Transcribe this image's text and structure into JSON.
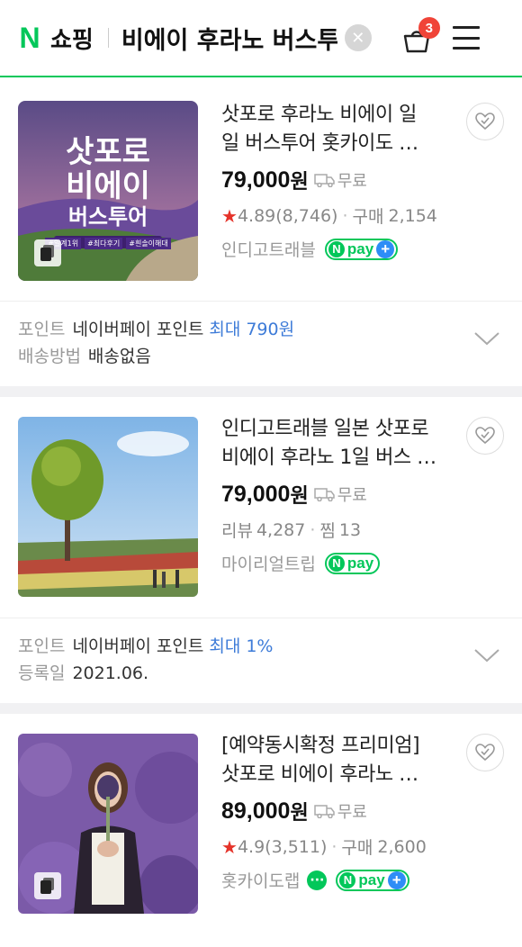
{
  "header": {
    "logo": "N",
    "brand": "쇼핑",
    "query": "비에이 후라노 버스투어",
    "clear_symbol": "✕",
    "cart_count": "3"
  },
  "products": [
    {
      "title_line1": "삿포로 후라노 비에이 일",
      "title_line2": "일 버스투어 홋카이도 …",
      "price": "79,000",
      "price_unit": "원",
      "shipping": "무료",
      "rating": "4.89",
      "reviews": "(8,746)",
      "purchase_label": "구매",
      "purchase_count": "2,154",
      "seller": "인디고트래블",
      "npay_text": "pay",
      "npay_plus": true,
      "image_text_1": "삿포로",
      "image_text_2": "비에이",
      "image_text_3": "버스투어",
      "image_tags": [
        "#일계1위",
        "#최다후기",
        "#흰솔이해대"
      ],
      "detail_label_1": "포인트",
      "detail_value_1": "네이버페이 포인트",
      "detail_highlight_1": "최대 790원",
      "detail_label_2": "배송방법",
      "detail_value_2": "배송없음"
    },
    {
      "title_line1": "인디고트래블 일본 삿포로",
      "title_line2": "비에이 후라노 1일 버스 …",
      "price": "79,000",
      "price_unit": "원",
      "shipping": "무료",
      "review_label": "리뷰",
      "review_count": "4,287",
      "zzim_label": "찜",
      "zzim_count": "13",
      "seller": "마이리얼트립",
      "npay_text": "pay",
      "npay_plus": false,
      "detail_label_1": "포인트",
      "detail_value_1": "네이버페이 포인트",
      "detail_highlight_1": "최대 1%",
      "detail_label_2": "등록일",
      "detail_value_2": "2021.06."
    },
    {
      "title_line1": "[예약동시확정 프리미엄]",
      "title_line2": "삿포로 비에이 후라노 …",
      "price": "89,000",
      "price_unit": "원",
      "shipping": "무료",
      "rating": "4.9",
      "reviews": "(3,511)",
      "purchase_label": "구매",
      "purchase_count": "2,600",
      "seller": "홋카이도랩",
      "talk_symbol": "···",
      "npay_text": "pay",
      "npay_plus": true
    }
  ],
  "colors": {
    "naver_green": "#03c75a",
    "badge_red": "#f04438",
    "star_red": "#e5332a",
    "point_blue": "#3d7bd8",
    "plus_blue": "#2e8df6"
  },
  "icons": [
    "naver-logo",
    "clear-icon",
    "cart-icon",
    "menu-icon",
    "heart-icon",
    "truck-icon",
    "star-icon",
    "chevron-down-icon",
    "talk-icon",
    "multi-image-icon"
  ]
}
